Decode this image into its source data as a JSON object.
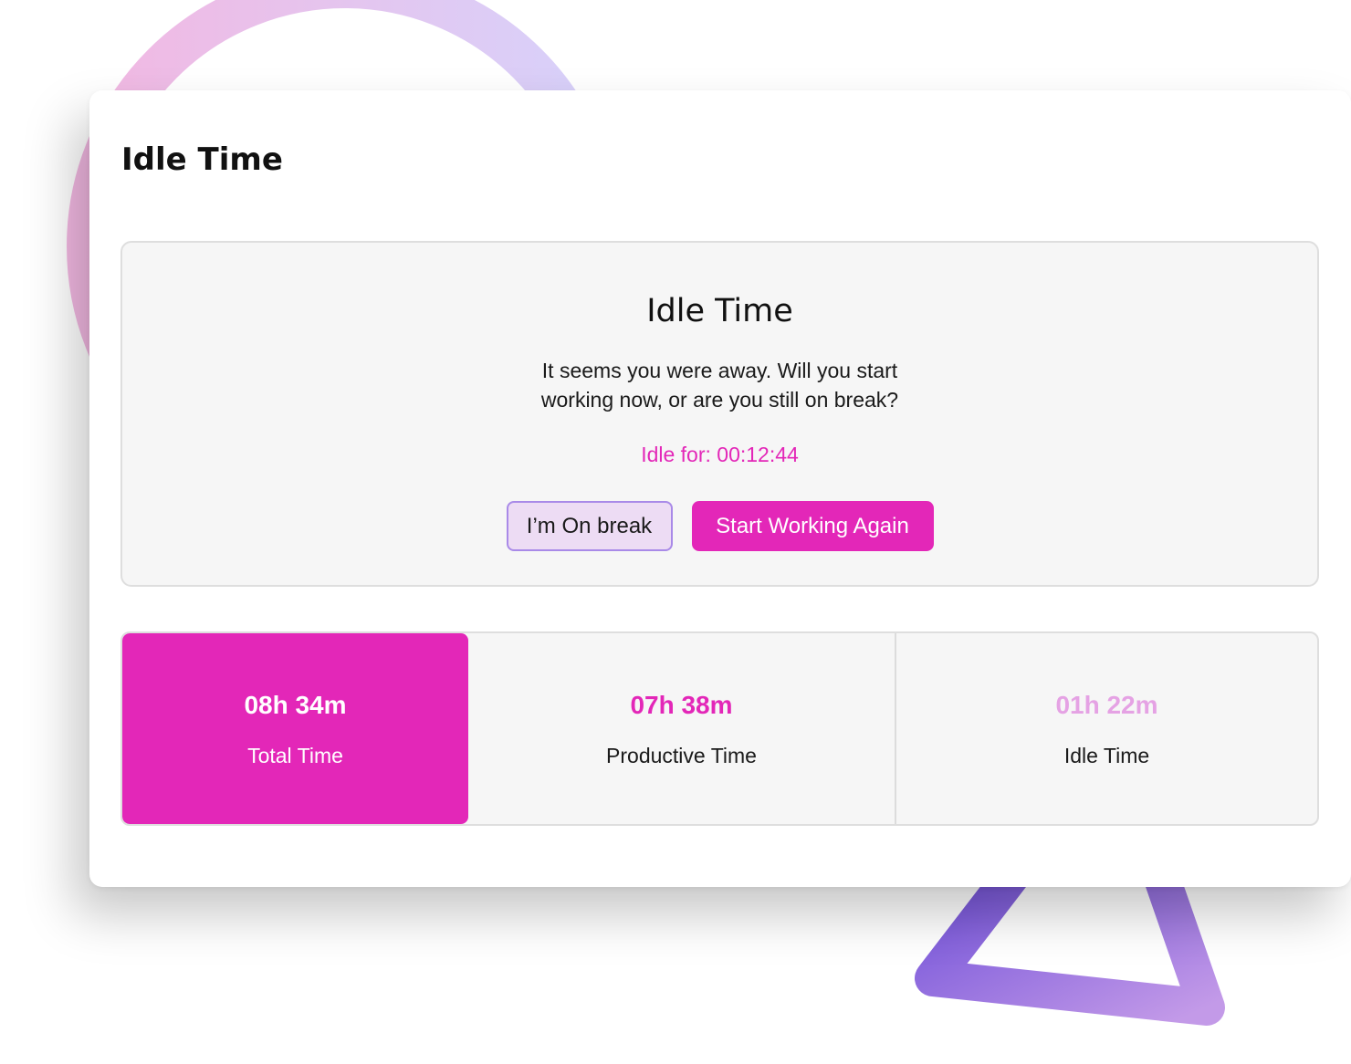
{
  "page": {
    "title": "Idle Time"
  },
  "dialog": {
    "title": "Idle Time",
    "message": "It seems you were away. Will you start working now, or are you still on break?",
    "idle_for": "Idle for: 00:12:44",
    "break_button": "I’m On break",
    "work_button": "Start Working Again"
  },
  "stats": [
    {
      "value": "08h 34m",
      "label": "Total Time"
    },
    {
      "value": "07h 38m",
      "label": "Productive Time"
    },
    {
      "value": "01h 22m",
      "label": "Idle Time"
    }
  ],
  "colors": {
    "accent": "#e327b8",
    "accent_light": "#e5a2e4",
    "break_button_bg": "#eddcf4",
    "break_button_border": "#a98ae8",
    "panel_bg": "#f6f6f6"
  }
}
